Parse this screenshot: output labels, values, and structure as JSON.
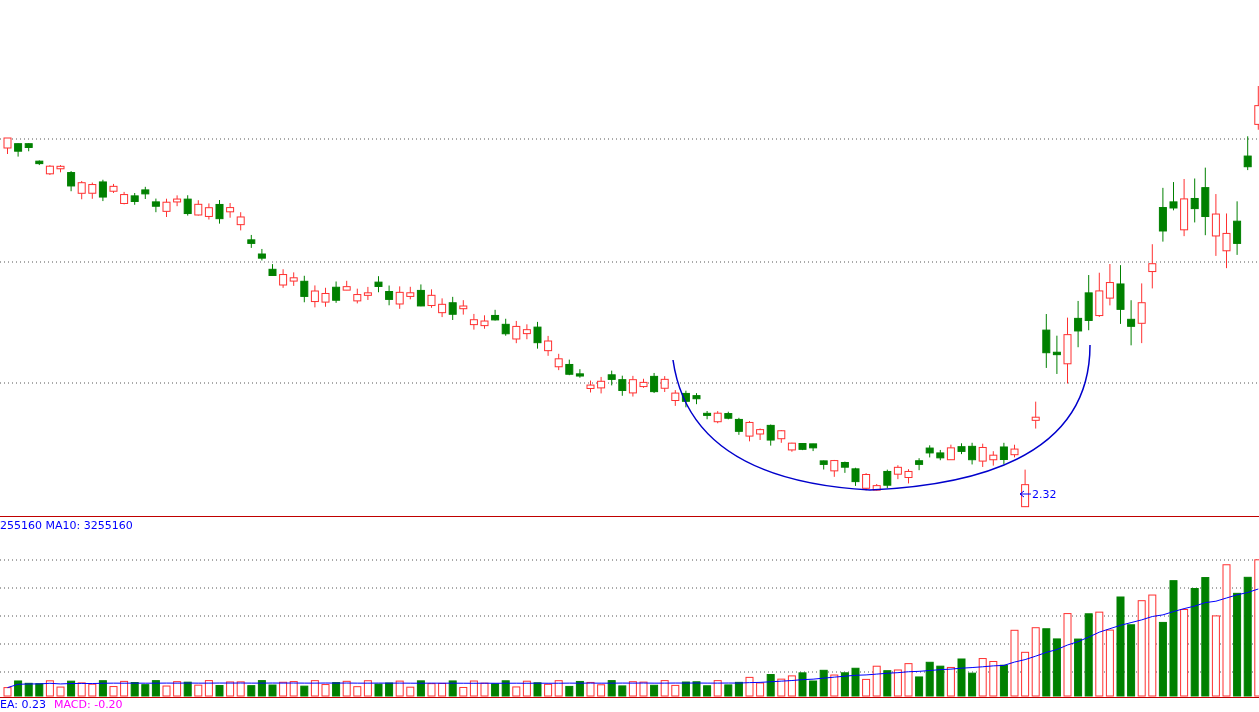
{
  "price_panel": {
    "low_marker": {
      "label": "2.32"
    }
  },
  "volume_panel": {
    "legend": "255160 MA10: 3255160"
  },
  "indicator_panel": {
    "legend": [
      {
        "text": "EA: 0.23",
        "color": "#0000ff"
      },
      {
        "text": "MACD: -0.20",
        "color": "#ff00ff"
      }
    ]
  }
}
